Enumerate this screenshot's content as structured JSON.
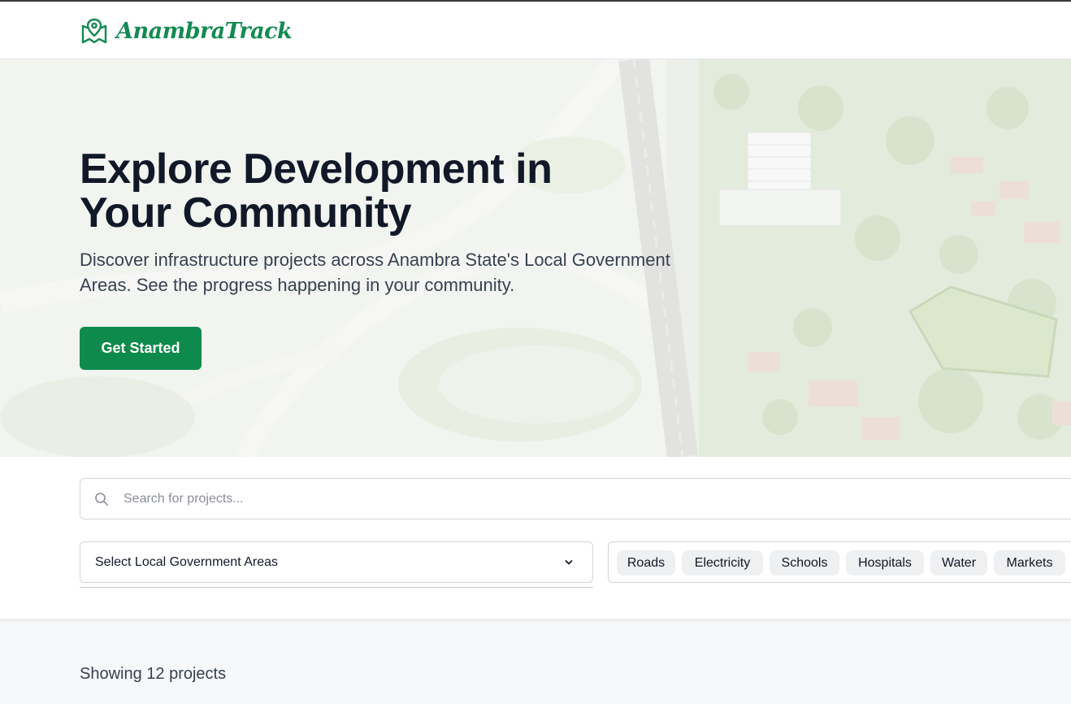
{
  "header": {
    "logo_text": "AnambraTrack",
    "logo_icon": "map-pin-icon"
  },
  "hero": {
    "title": "Explore Development in Your Community",
    "subtitle": "Discover infrastructure projects across Anambra State's Local Government Areas. See the progress happening in your community.",
    "cta_label": "Get Started"
  },
  "search": {
    "placeholder": "Search for projects...",
    "value": "",
    "icon": "search-icon"
  },
  "lga_select": {
    "selected": "Select Local Government Areas",
    "icon": "chevron-down-icon"
  },
  "categories": [
    "Roads",
    "Electricity",
    "Schools",
    "Hospitals",
    "Water",
    "Markets"
  ],
  "results": {
    "summary": "Showing 12 projects"
  },
  "colors": {
    "brand": "#0f8a4d",
    "text": "#111827",
    "muted": "#374151"
  }
}
